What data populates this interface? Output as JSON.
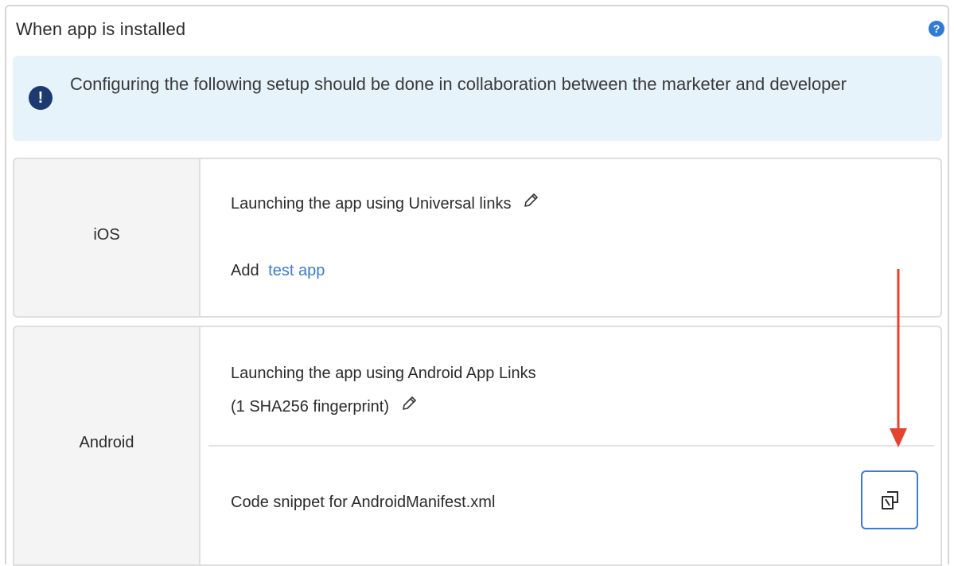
{
  "section": {
    "title": "When app is installed",
    "help_icon": "question-circle-icon"
  },
  "alert": {
    "icon": "exclamation-circle-icon",
    "text": "Configuring the following setup should be done in collaboration between the marketer and developer",
    "bg_color": "#e6f3fb"
  },
  "ios": {
    "platform": "iOS",
    "heading": "Launching the app using Universal links",
    "add_label": "Add",
    "add_link": "test app"
  },
  "android": {
    "platform": "Android",
    "heading_line1": "Launching the app using Android App Links",
    "heading_line2": "(1 SHA256 fingerprint)",
    "snippet_label": "Code snippet for AndroidManifest.xml",
    "copy_icon": "copy-icon"
  },
  "colors": {
    "accent": "#3a7ccf",
    "annotation_arrow": "#e5432f"
  }
}
